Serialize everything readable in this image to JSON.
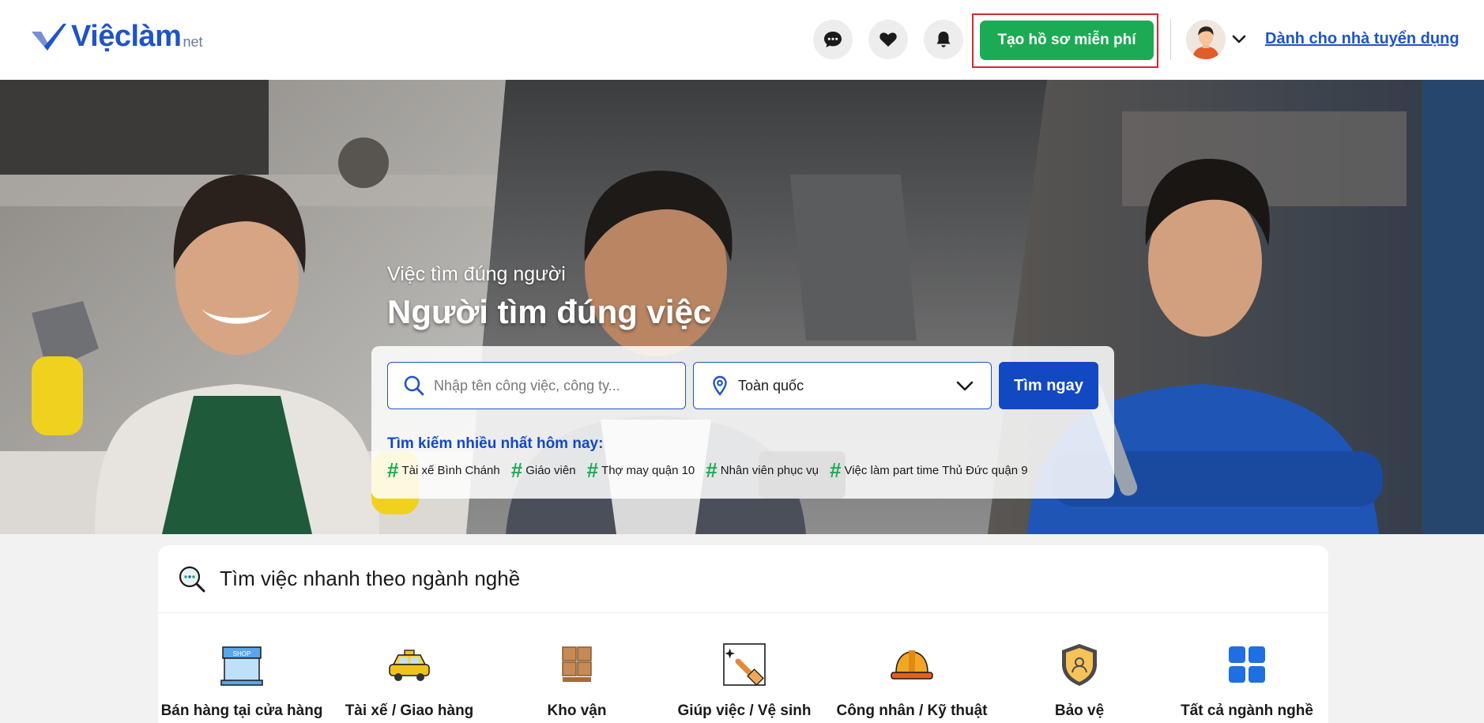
{
  "header": {
    "logo_text": "Việclàm",
    "logo_suffix": "net",
    "icons": [
      "chat-icon",
      "heart-icon",
      "bell-icon"
    ],
    "cta_label": "Tạo hồ sơ miễn phí",
    "employer_link": "Dành cho nhà tuyển dụng"
  },
  "hero": {
    "subtitle": "Việc tìm đúng người",
    "title": "Người tìm đúng việc",
    "search": {
      "placeholder": "Nhập tên công việc, công ty...",
      "location_value": "Toàn quốc",
      "button_label": "Tìm ngay"
    },
    "trending_label": "Tìm kiếm nhiều nhất hôm nay:",
    "trending": [
      "Tài xế Bình Chánh",
      "Giáo viên",
      "Thợ may quận 10",
      "Nhân viên phục vụ",
      "Việc làm part time Thủ Đức quận 9"
    ]
  },
  "categories": {
    "title": "Tìm việc nhanh theo ngành nghề",
    "items": [
      {
        "icon": "shop-icon",
        "label": "Bán hàng tại cửa hàng"
      },
      {
        "icon": "taxi-icon",
        "label": "Tài xế / Giao hàng"
      },
      {
        "icon": "boxes-icon",
        "label": "Kho vận"
      },
      {
        "icon": "cleaning-icon",
        "label": "Giúp việc / Vệ sinh"
      },
      {
        "icon": "worker-helmet-icon",
        "label": "Công nhân / Kỹ thuật"
      },
      {
        "icon": "security-shield-icon",
        "label": "Bảo vệ"
      },
      {
        "icon": "grid-icon",
        "label": "Tất cả ngành nghề"
      }
    ]
  },
  "colors": {
    "brand_blue": "#1f54c6",
    "cta_green": "#1daa55",
    "search_button": "#1249c2",
    "highlight_frame": "#d7272f"
  }
}
